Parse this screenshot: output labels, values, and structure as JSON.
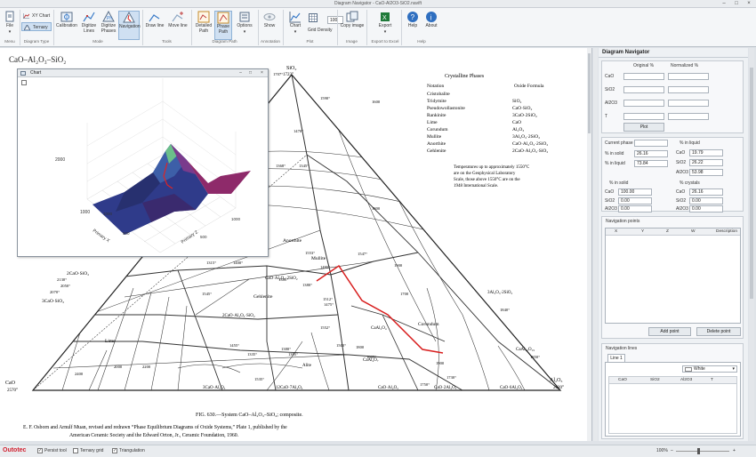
{
  "window": {
    "title": "Diagram Navigator - CaO-Al2O3-SiO2.navift"
  },
  "ribbon": {
    "file_label": "File",
    "xy_chart_label": "XY Chart",
    "ternary_label": "Ternary",
    "calibration_label": "Calibration",
    "digitize_lines_label": "Digitize Lines",
    "digitize_phases_label": "Digitize Phases",
    "navigation_label": "Navigation",
    "draw_line_label": "Draw line",
    "move_line_label": "Move line",
    "detailed_path_label": "Detailed Path",
    "phase_path_label": "Phase Path",
    "options_label": "Options",
    "show_label": "Show",
    "chart_label": "Chart",
    "grid_density_value": "100",
    "grid_density_label": "Grid Density",
    "copy_image_label": "Copy image",
    "export_label": "Export",
    "help_label": "Help",
    "about_label": "About",
    "groups": {
      "menu": "Menu",
      "diagram_type": "Diagram Type",
      "mode": "Mode",
      "tools": "Tools",
      "diagram_path": "Diagram Path",
      "annotation": "Annotation",
      "plot": "Plot",
      "image": "Image",
      "export_excel": "Export to Excel",
      "help": "Help"
    }
  },
  "diagram": {
    "title": "CaO–Al₂O₃–SiO₂",
    "caption": "FIG. 630.—System CaO–Al₂O₃–SiO₂; composite.",
    "credit1": "E. F. Osborn and Arnulf Muan, revised and redrawn “Phase Equilibrium Diagrams of Oxide Systems,” Plate 1, published by the",
    "credit2": "American Ceramic Society and the Edward Orton, Jr., Ceramic Foundation, 1960.",
    "legend_title": "Crystalline  Phases",
    "legend_col1": "Notation",
    "legend_col2": "Oxide Formula",
    "legend_rows": [
      {
        "name": "Cristobalite",
        "formula": ""
      },
      {
        "name": "Tridymite",
        "formula": "SiO₂"
      },
      {
        "name": "Pseudowollastonite",
        "formula": "CaO·SiO₂"
      },
      {
        "name": "Rankinite",
        "formula": "3CaO·2SiO₂"
      },
      {
        "name": "Lime",
        "formula": "CaO"
      },
      {
        "name": "Corundum",
        "formula": "Al₂O₃"
      },
      {
        "name": "Mullite",
        "formula": "3Al₂O₃·2SiO₂"
      },
      {
        "name": "Anorthite",
        "formula": "CaO·Al₂O₃·2SiO₂"
      },
      {
        "name": "Gehlenite",
        "formula": "2CaO·Al₂O₃·SiO₂"
      }
    ],
    "note_lines": [
      "Temperatures up to approximately 1550°C",
      "are on the Geophysical Laboratory",
      "Scale, those above 1550°C are on the",
      "1948 International Scale."
    ],
    "apex_sio2": "SiO₂",
    "apex_sio2_temp": "1723°",
    "apex_cao": "CaO",
    "apex_cao_temp": "2570°",
    "apex_al2o3": "Al₂O₃",
    "apex_al2o3_temp": "2020°",
    "labels": {
      "mullite": "Mullite",
      "anorthite": "Anorthite",
      "corundum": "Corundum",
      "gehlenite": "Gehlenite",
      "lime": "Lime",
      "c2s": "2CaO·SiO₂",
      "c3s": "3CaO·SiO₂",
      "c2as": "2CaO·Al₂O₃·SiO₂",
      "cas2": "CaO·Al₂O₃·2SiO₂",
      "a3s2": "3Al₂O₃·2SiO₂",
      "ca": "CaAl₂O₄",
      "ca2": "CaAl₄O₇",
      "c12a7": "12CaO·7Al₂O₃",
      "c3a": "3CaO·Al₂O₃",
      "ca_b": "CaO·Al₂O₃",
      "ca2_b": "CaO·2Al₂O₃",
      "ca6": "CaO·6Al₂O₃",
      "cao_al": "CaAl₁₂O₁₉",
      "alite": "Alite"
    },
    "temps": [
      "1590°",
      "1470°",
      "1368°",
      "1345°",
      "1315°",
      "1400°",
      "1553°",
      "1547°",
      "1495°",
      "1385°",
      "1380°",
      "1545°",
      "1512°",
      "1475°",
      "1552°",
      "1500°",
      "1455°",
      "1335°",
      "1380°",
      "1395°",
      "1535°",
      "1605°",
      "1730°",
      "1750°",
      "1840°",
      "1850°",
      "2130°",
      "2050°",
      "2070°",
      "1707°",
      "1600",
      "1800",
      "1900",
      "1700",
      "2000",
      "2200",
      "2400",
      "1800",
      "1900"
    ]
  },
  "chart_window": {
    "title": "Chart",
    "axis_primary_x": "Primary X",
    "axis_primary_z": "Primary Z",
    "tick_2000": "2000",
    "tick_1000": "1000",
    "ticks_x": [
      "1000",
      "500"
    ],
    "ticks_z": [
      "1000",
      "500"
    ]
  },
  "navigator": {
    "title": "Diagram Navigator",
    "col_original": "Original %",
    "col_normalized": "Normalized %",
    "row_labels": [
      "CaO",
      "SiO2",
      "Al2O3",
      "T"
    ],
    "plot_button": "Plot",
    "current_phase_label": "Current phase",
    "pct_in_liquid_header": "% in liquid",
    "pct_in_solid_label": "% in solid",
    "pct_in_solid_value": "26.16",
    "pct_in_liquid_label": "% in liquid",
    "pct_in_liquid_value": "73.84",
    "liquid": [
      {
        "name": "CaO",
        "value": "19.79"
      },
      {
        "name": "SiO2",
        "value": "26.22"
      },
      {
        "name": "Al2O3",
        "value": "53.98"
      }
    ],
    "solid_header": "% in solid",
    "crystals_header": "% crystals",
    "solid": [
      {
        "name": "CaO",
        "value": "100.00"
      },
      {
        "name": "SiO2",
        "value": "0.00"
      },
      {
        "name": "Al2O3",
        "value": "0.00"
      }
    ],
    "crystals": [
      {
        "name": "CaO",
        "value": "26.16"
      },
      {
        "name": "SiO2",
        "value": "0.00"
      },
      {
        "name": "Al2O3",
        "value": "0.00"
      }
    ],
    "nav_points_label": "Navigation points",
    "nav_cols": [
      "X",
      "Y",
      "Z",
      "W",
      "Description"
    ],
    "add_point": "Add point",
    "delete_point": "Delete point",
    "nav_lines_label": "Navigation lines",
    "line_tab": "Line 1",
    "line_color": "White",
    "line_cols": [
      "CaO",
      "SiO2",
      "Al2O3",
      "T"
    ]
  },
  "status": {
    "brand": "Outotec",
    "persist_tool": "Persist tool",
    "ternary_grid": "Ternary grid",
    "triangulation": "Triangulation",
    "zoom": "100%"
  },
  "colors": {
    "path": "#d81f1f",
    "ribbon_active": "#cfe0f2",
    "brand": "#d1202f"
  }
}
